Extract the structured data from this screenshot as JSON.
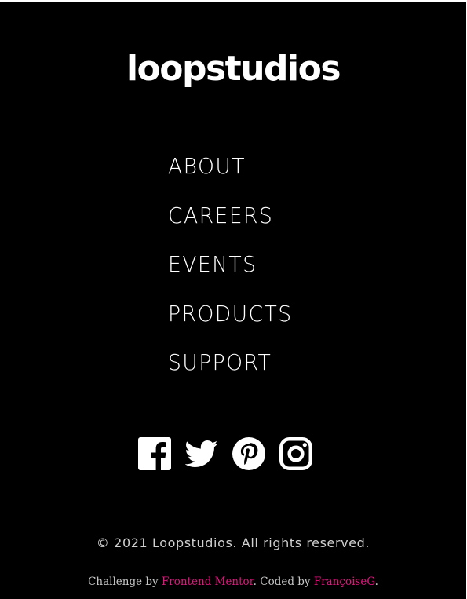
{
  "brand": {
    "logo_text": "loopstudios"
  },
  "nav": {
    "items": [
      {
        "label": "ABOUT"
      },
      {
        "label": "CAREERS"
      },
      {
        "label": "EVENTS"
      },
      {
        "label": "PRODUCTS"
      },
      {
        "label": "SUPPORT"
      }
    ]
  },
  "social": {
    "icons": [
      "facebook-icon",
      "twitter-icon",
      "pinterest-icon",
      "instagram-icon"
    ]
  },
  "footer": {
    "copyright": "© 2021 Loopstudios. All rights reserved.",
    "attribution": {
      "prefix": "Challenge by ",
      "challenge_link": "Frontend Mentor",
      "middle": ". Coded by ",
      "author_link": "FrançoiseG",
      "suffix": "."
    }
  },
  "colors": {
    "background": "#000000",
    "text": "#ffffff",
    "muted_text": "#cccccc",
    "link_accent": "#e2167f"
  }
}
